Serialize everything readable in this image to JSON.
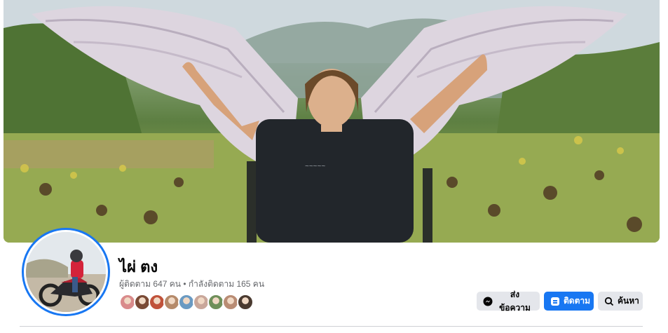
{
  "profile": {
    "name": "ไผ่ ตง",
    "followers_text": "ผู้ติดตาม 647 คน",
    "separator": "•",
    "following_text": "กำลังติดตาม 165 คน"
  },
  "friends": [
    {
      "color": "#d98b8b"
    },
    {
      "color": "#7a4a35"
    },
    {
      "color": "#c0523a"
    },
    {
      "color": "#b58a6a"
    },
    {
      "color": "#6a9ac2"
    },
    {
      "color": "#c9a79a"
    },
    {
      "color": "#6f8f5a"
    },
    {
      "color": "#b98c74"
    },
    {
      "color": "#4a3a30"
    }
  ],
  "actions": {
    "message_label": "ส่งข้อความ",
    "follow_label": "ติดตาม",
    "search_label": "ค้นหา"
  },
  "colors": {
    "accent": "#1877f2",
    "secondary_button": "#e4e6eb",
    "text_primary": "#050505",
    "text_secondary": "#65676b"
  }
}
